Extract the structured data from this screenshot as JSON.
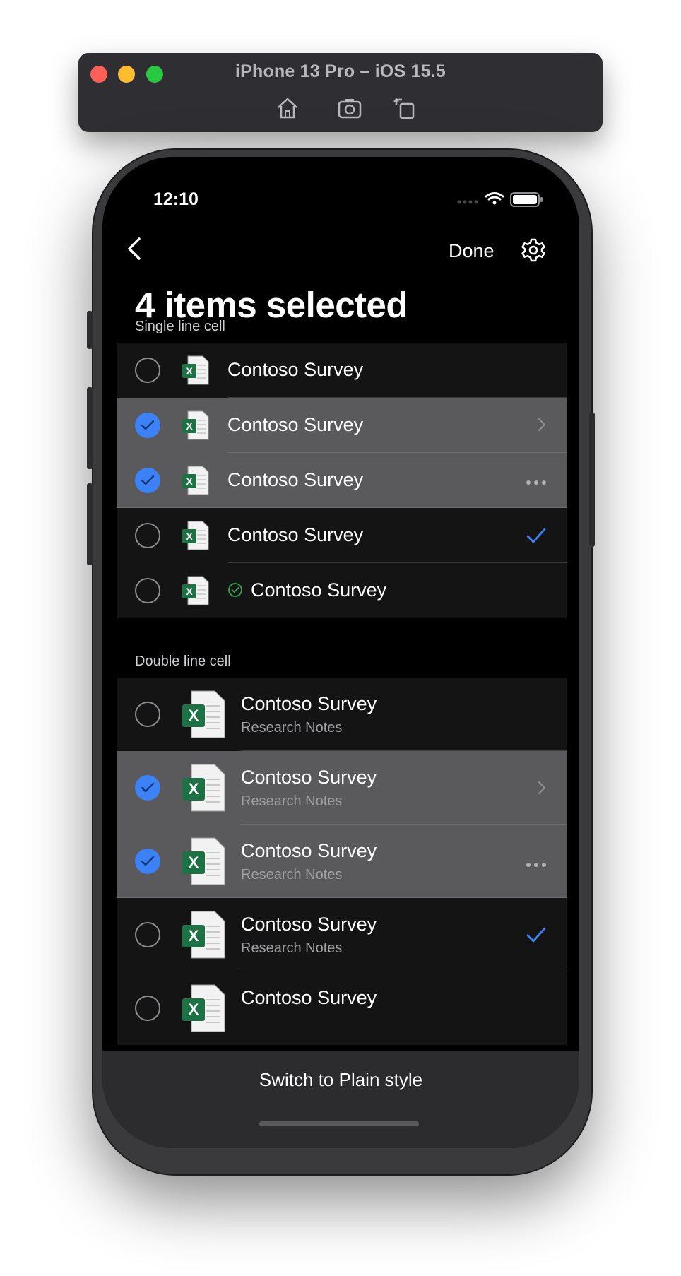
{
  "simulator": {
    "title": "iPhone 13 Pro – iOS 15.5",
    "tools": [
      "home-icon",
      "screenshot-icon",
      "rotate-icon"
    ]
  },
  "status_bar": {
    "time": "12:10"
  },
  "nav": {
    "done_label": "Done"
  },
  "page": {
    "title": "4 items selected"
  },
  "single_section": {
    "header": "Single line cell",
    "rows": [
      {
        "title": "Contoso Survey",
        "selected": false,
        "accessory": "none"
      },
      {
        "title": "Contoso Survey",
        "selected": true,
        "accessory": "chevron"
      },
      {
        "title": "Contoso Survey",
        "selected": true,
        "accessory": "more"
      },
      {
        "title": "Contoso Survey",
        "selected": false,
        "accessory": "checkmark"
      },
      {
        "title": "Contoso Survey",
        "selected": false,
        "accessory": "none",
        "status_icon": "check-circle"
      }
    ]
  },
  "double_section": {
    "header": "Double line cell",
    "rows": [
      {
        "title": "Contoso Survey",
        "subtitle": "Research Notes",
        "selected": false,
        "accessory": "none"
      },
      {
        "title": "Contoso Survey",
        "subtitle": "Research Notes",
        "selected": true,
        "accessory": "chevron"
      },
      {
        "title": "Contoso Survey",
        "subtitle": "Research Notes",
        "selected": true,
        "accessory": "more"
      },
      {
        "title": "Contoso Survey",
        "subtitle": "Research Notes",
        "selected": false,
        "accessory": "checkmark"
      },
      {
        "title": "Contoso Survey",
        "subtitle": "",
        "selected": false,
        "accessory": "none"
      }
    ]
  },
  "bottom_bar": {
    "button_label": "Switch to Plain style"
  },
  "colors": {
    "accent": "#3c82f6",
    "excel": "#1e7145",
    "selected_bg": "#5a5a5c"
  }
}
